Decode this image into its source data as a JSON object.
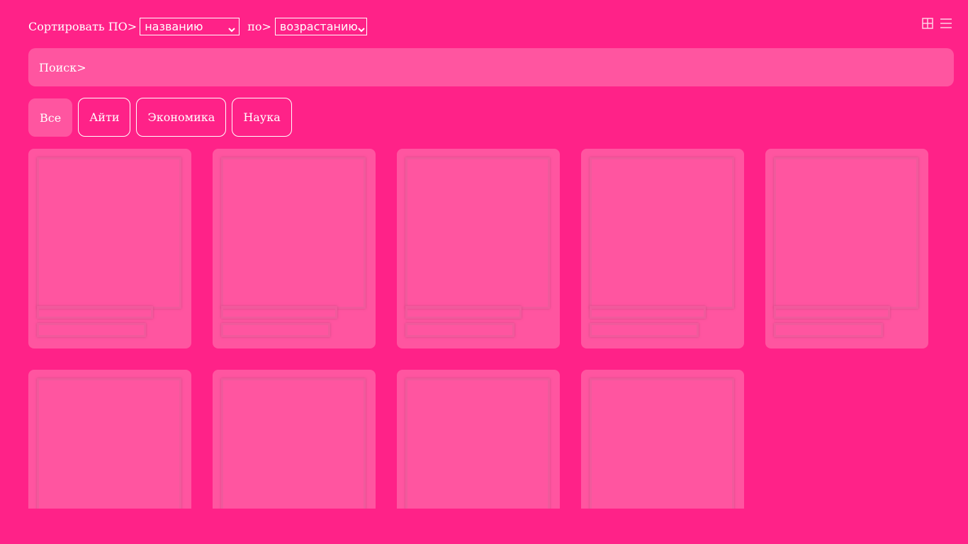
{
  "sort": {
    "label": "Сортировать ПО>",
    "field_value": "названию",
    "order_label": "по>",
    "order_value": "возрастанию"
  },
  "view_toggle": {
    "icons": [
      "grid-view-icon",
      "list-view-icon"
    ]
  },
  "search": {
    "label": "Поиск>"
  },
  "filters": [
    "Все",
    "Айти",
    "Экономика",
    "Наука"
  ],
  "active_filter": "Все",
  "cards_count": 9,
  "colors": {
    "background": "#ff2288",
    "panel": "#ff55a0",
    "text": "#ffffff"
  }
}
